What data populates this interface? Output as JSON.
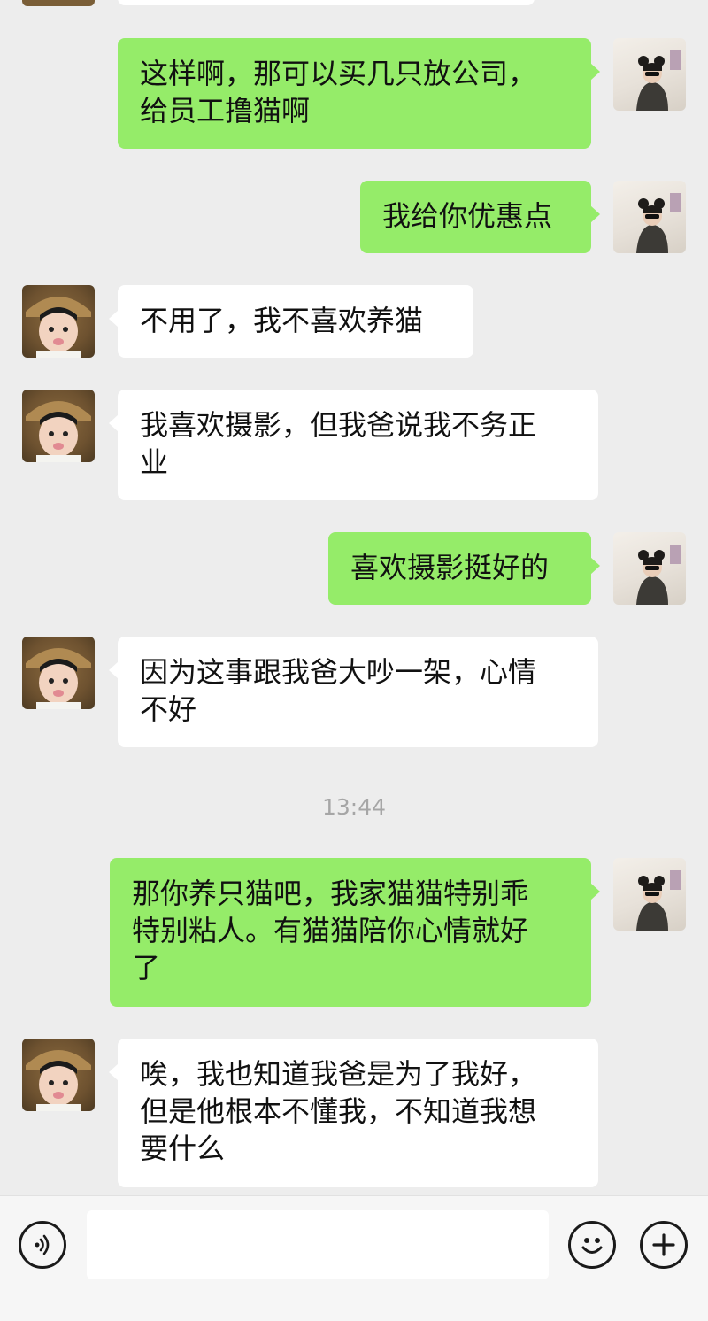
{
  "colors": {
    "outgoing_bubble": "#95ec69",
    "incoming_bubble": "#ffffff",
    "background": "#ededed"
  },
  "messages": [
    {
      "sender": "me",
      "text": "这样啊，那可以买几只放公司，\n给员工撸猫啊"
    },
    {
      "sender": "me",
      "text": "我给你优惠点"
    },
    {
      "sender": "friend",
      "text": "不用了，我不喜欢养猫"
    },
    {
      "sender": "friend",
      "text": "我喜欢摄影，但我爸说我不务正\n业"
    },
    {
      "sender": "me",
      "text": "喜欢摄影挺好的"
    },
    {
      "sender": "friend",
      "text": "因为这事跟我爸大吵一架，心情\n不好"
    },
    {
      "sender": "me",
      "text": "那你养只猫吧，我家猫猫特别乖\n特别粘人。有猫猫陪你心情就好\n了"
    },
    {
      "sender": "friend",
      "text": "唉，我也知道我爸是为了我好，\n但是他根本不懂我，不知道我想\n要什么"
    }
  ],
  "timestamp": "13:44",
  "input_bar": {
    "voice_icon": "voice-icon",
    "emoji_icon": "emoji-icon",
    "plus_icon": "plus-icon",
    "text": ""
  }
}
